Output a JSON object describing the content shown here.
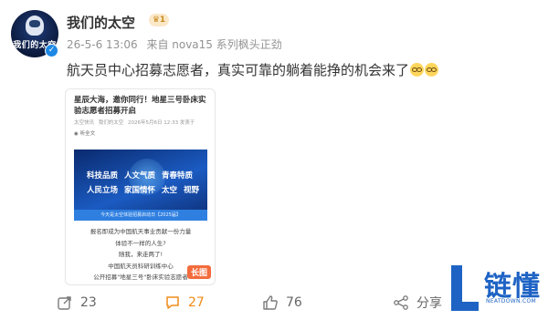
{
  "post": {
    "author": {
      "name": "我们的太空",
      "avatar_text": "我们的太空",
      "level": "1"
    },
    "meta": {
      "time": "26-5-6 13:06",
      "source": "来自 nova15 系列枫头正劲"
    },
    "text": "航天员中心招募志愿者，真实可靠的躺着能挣的机会来了",
    "emoji": "doge-emoji"
  },
  "card": {
    "title": "星辰大海，邀你同行！地星三号卧床实验志愿者招募开启",
    "meta_source": "太空快讯",
    "meta_author": "我们的太空",
    "meta_time": "2026年5月6日 12:33 发表于",
    "listen_label": "听全文",
    "banner_row1": [
      "科技品质",
      "人文气质",
      "青春特质"
    ],
    "banner_row2": [
      "人民立场",
      "家国情怀",
      "太空",
      "视野"
    ],
    "banner_strip": "今天是太空体验招募启动日【2025届】",
    "lines": [
      "报名即成为中国航天事业贡献一份力量",
      "体验不一样的人生?",
      "随我，来走两了!",
      "中国航天员科研训练中心",
      "公开招募\"地星三号\"卧床实验志愿者"
    ],
    "long_image_tag": "长图"
  },
  "actions": {
    "share_count": "23",
    "comment_count": "27",
    "like_count": "76",
    "share_label": "分享"
  },
  "watermark": {
    "text": "链懂",
    "sub": "NEATDOWN.COM"
  },
  "colors": {
    "comment_active": "#f08b18",
    "verify_blue": "#1e88e5",
    "watermark_blue": "#1e63c4"
  }
}
